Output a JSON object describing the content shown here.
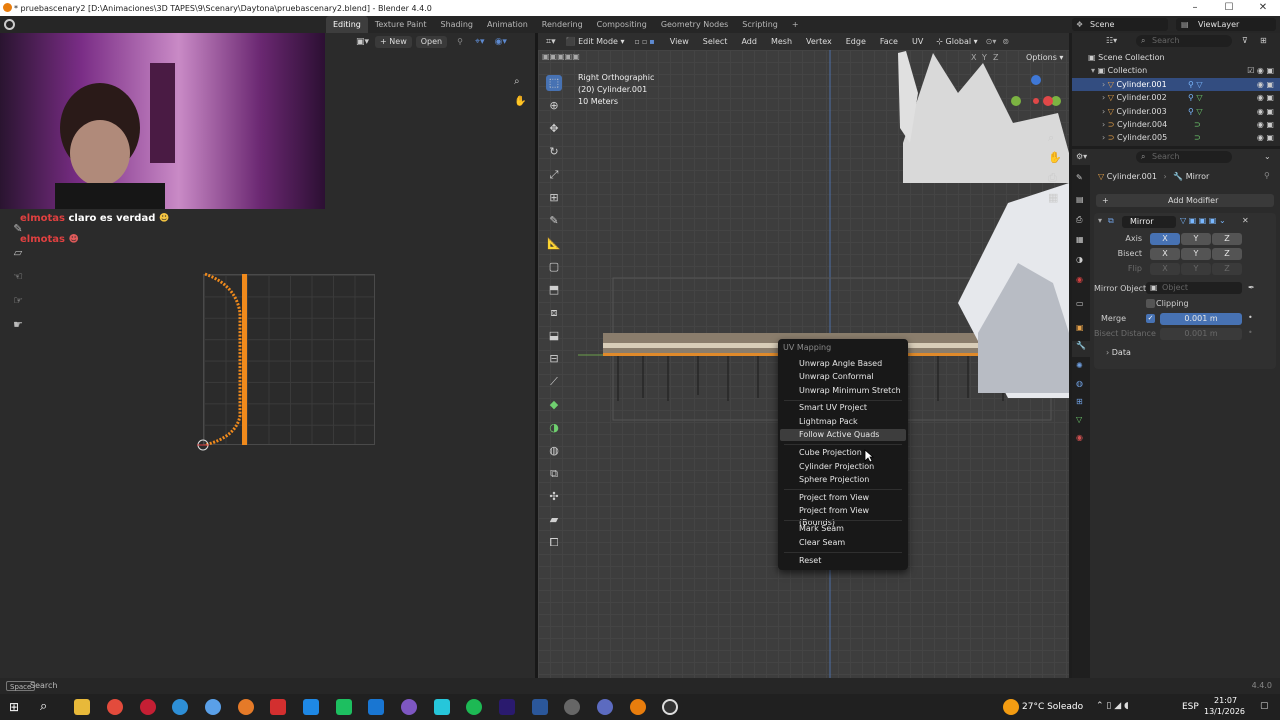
{
  "window": {
    "title": "* pruebascenary2 [D:\\Animaciones\\3D TAPES\\9\\Scenary\\Daytona\\pruebascenary2.blend] - Blender 4.4.0",
    "controls": [
      "–",
      "☐",
      "✕"
    ]
  },
  "workspace_tabs": [
    "Editing",
    "Texture Paint",
    "Shading",
    "Animation",
    "Rendering",
    "Compositing",
    "Geometry Nodes",
    "Scripting",
    "+"
  ],
  "scene": {
    "name": "Scene",
    "view_layer": "ViewLayer"
  },
  "uv_editor": {
    "buttons": {
      "new": "New",
      "open": "Open"
    },
    "chat": [
      {
        "name": "elmotas",
        "message": "claro es verdad"
      },
      {
        "name": "elmotas",
        "message": ""
      }
    ]
  },
  "viewport": {
    "mode": "Edit Mode",
    "menus": [
      "View",
      "Select",
      "Add",
      "Mesh",
      "Vertex",
      "Edge",
      "Face",
      "UV"
    ],
    "transform": "Global",
    "options": "Options",
    "axes_labels": [
      "X",
      "Y",
      "Z"
    ],
    "info": {
      "view": "Right Orthographic",
      "object": "(20) Cylinder.001",
      "scale": "10 Meters"
    }
  },
  "uv_menu": {
    "title": "UV Mapping",
    "groups": [
      [
        "Unwrap Angle Based",
        "Unwrap Conformal",
        "Unwrap Minimum Stretch"
      ],
      [
        "Smart UV Project",
        "Lightmap Pack",
        "Follow Active Quads"
      ],
      [
        "Cube Projection",
        "Cylinder Projection",
        "Sphere Projection"
      ],
      [
        "Project from View",
        "Project from View (Bounds)"
      ],
      [
        "Mark Seam",
        "Clear Seam"
      ],
      [
        "Reset"
      ]
    ],
    "highlighted": "Follow Active Quads"
  },
  "outliner": {
    "search_placeholder": "Search",
    "root": "Scene Collection",
    "collection": "Collection",
    "objects": [
      "Cylinder.001",
      "Cylinder.002",
      "Cylinder.003",
      "Cylinder.004",
      "Cylinder.005"
    ],
    "selected": "Cylinder.001"
  },
  "properties": {
    "search_placeholder": "Search",
    "breadcrumb": {
      "object": "Cylinder.001",
      "modifier": "Mirror"
    },
    "add_modifier": "Add Modifier",
    "modifier_name": "Mirror",
    "axis_label": "Axis",
    "bisect_label": "Bisect",
    "flip_label": "Flip",
    "axes": [
      "X",
      "Y",
      "Z"
    ],
    "mirror_object_label": "Mirror Object",
    "mirror_object_placeholder": "Object",
    "clipping_label": "Clipping",
    "merge_label": "Merge",
    "merge_value": "0.001 m",
    "bisect_distance_label": "Bisect Distance",
    "bisect_distance_value": "0.001 m",
    "data_label": "Data"
  },
  "statusbar": {
    "key": "Space",
    "action": "Search",
    "version": "4.4.0"
  },
  "taskbar": {
    "weather": "27°C  Soleado",
    "lang": "ESP",
    "time": "21:07",
    "date": "13/1/2026"
  }
}
